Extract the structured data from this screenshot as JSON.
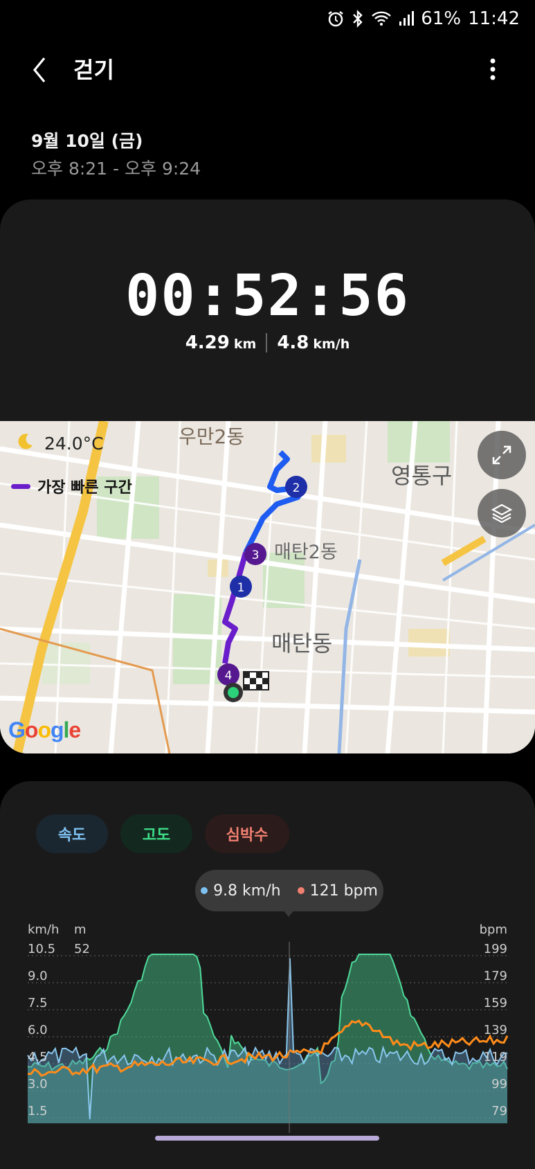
{
  "status_bar": {
    "battery": "61%",
    "time": "11:42"
  },
  "header": {
    "title": "걷기",
    "date": "9월 10일 (금)",
    "time_range": "오후 8:21 - 오후 9:24"
  },
  "summary": {
    "duration": "00:52:56",
    "distance_value": "4.29",
    "distance_unit": "km",
    "speed_value": "4.8",
    "speed_unit": "km/h"
  },
  "map": {
    "weather_temp": "24.0°C",
    "legend_label": "가장 빠른 구간",
    "place_labels": [
      "우만2동",
      "영통구",
      "매탄2동",
      "매탄동"
    ],
    "markers": [
      "1",
      "2",
      "3",
      "4"
    ],
    "attribution": "Google"
  },
  "chart": {
    "tabs": [
      "속도",
      "고도",
      "심박수"
    ],
    "tooltip": {
      "speed": "9.8 km/h",
      "hr": "121 bpm"
    },
    "left_unit": "km/h",
    "mid_unit": "m",
    "right_unit": "bpm",
    "left_ticks": [
      "10.5",
      "9.0",
      "7.5",
      "6.0",
      "4.5",
      "3.0",
      "1.5"
    ],
    "mid_ticks": [
      "52"
    ],
    "right_ticks": [
      "199",
      "179",
      "159",
      "139",
      "119",
      "99",
      "79"
    ]
  },
  "colors": {
    "speed": "#7fc2f2",
    "altitude": "#3fe08b",
    "heart_rate": "#f08070",
    "fastest_segment": "#6a1ecb",
    "route": "#1e5bf0"
  }
}
